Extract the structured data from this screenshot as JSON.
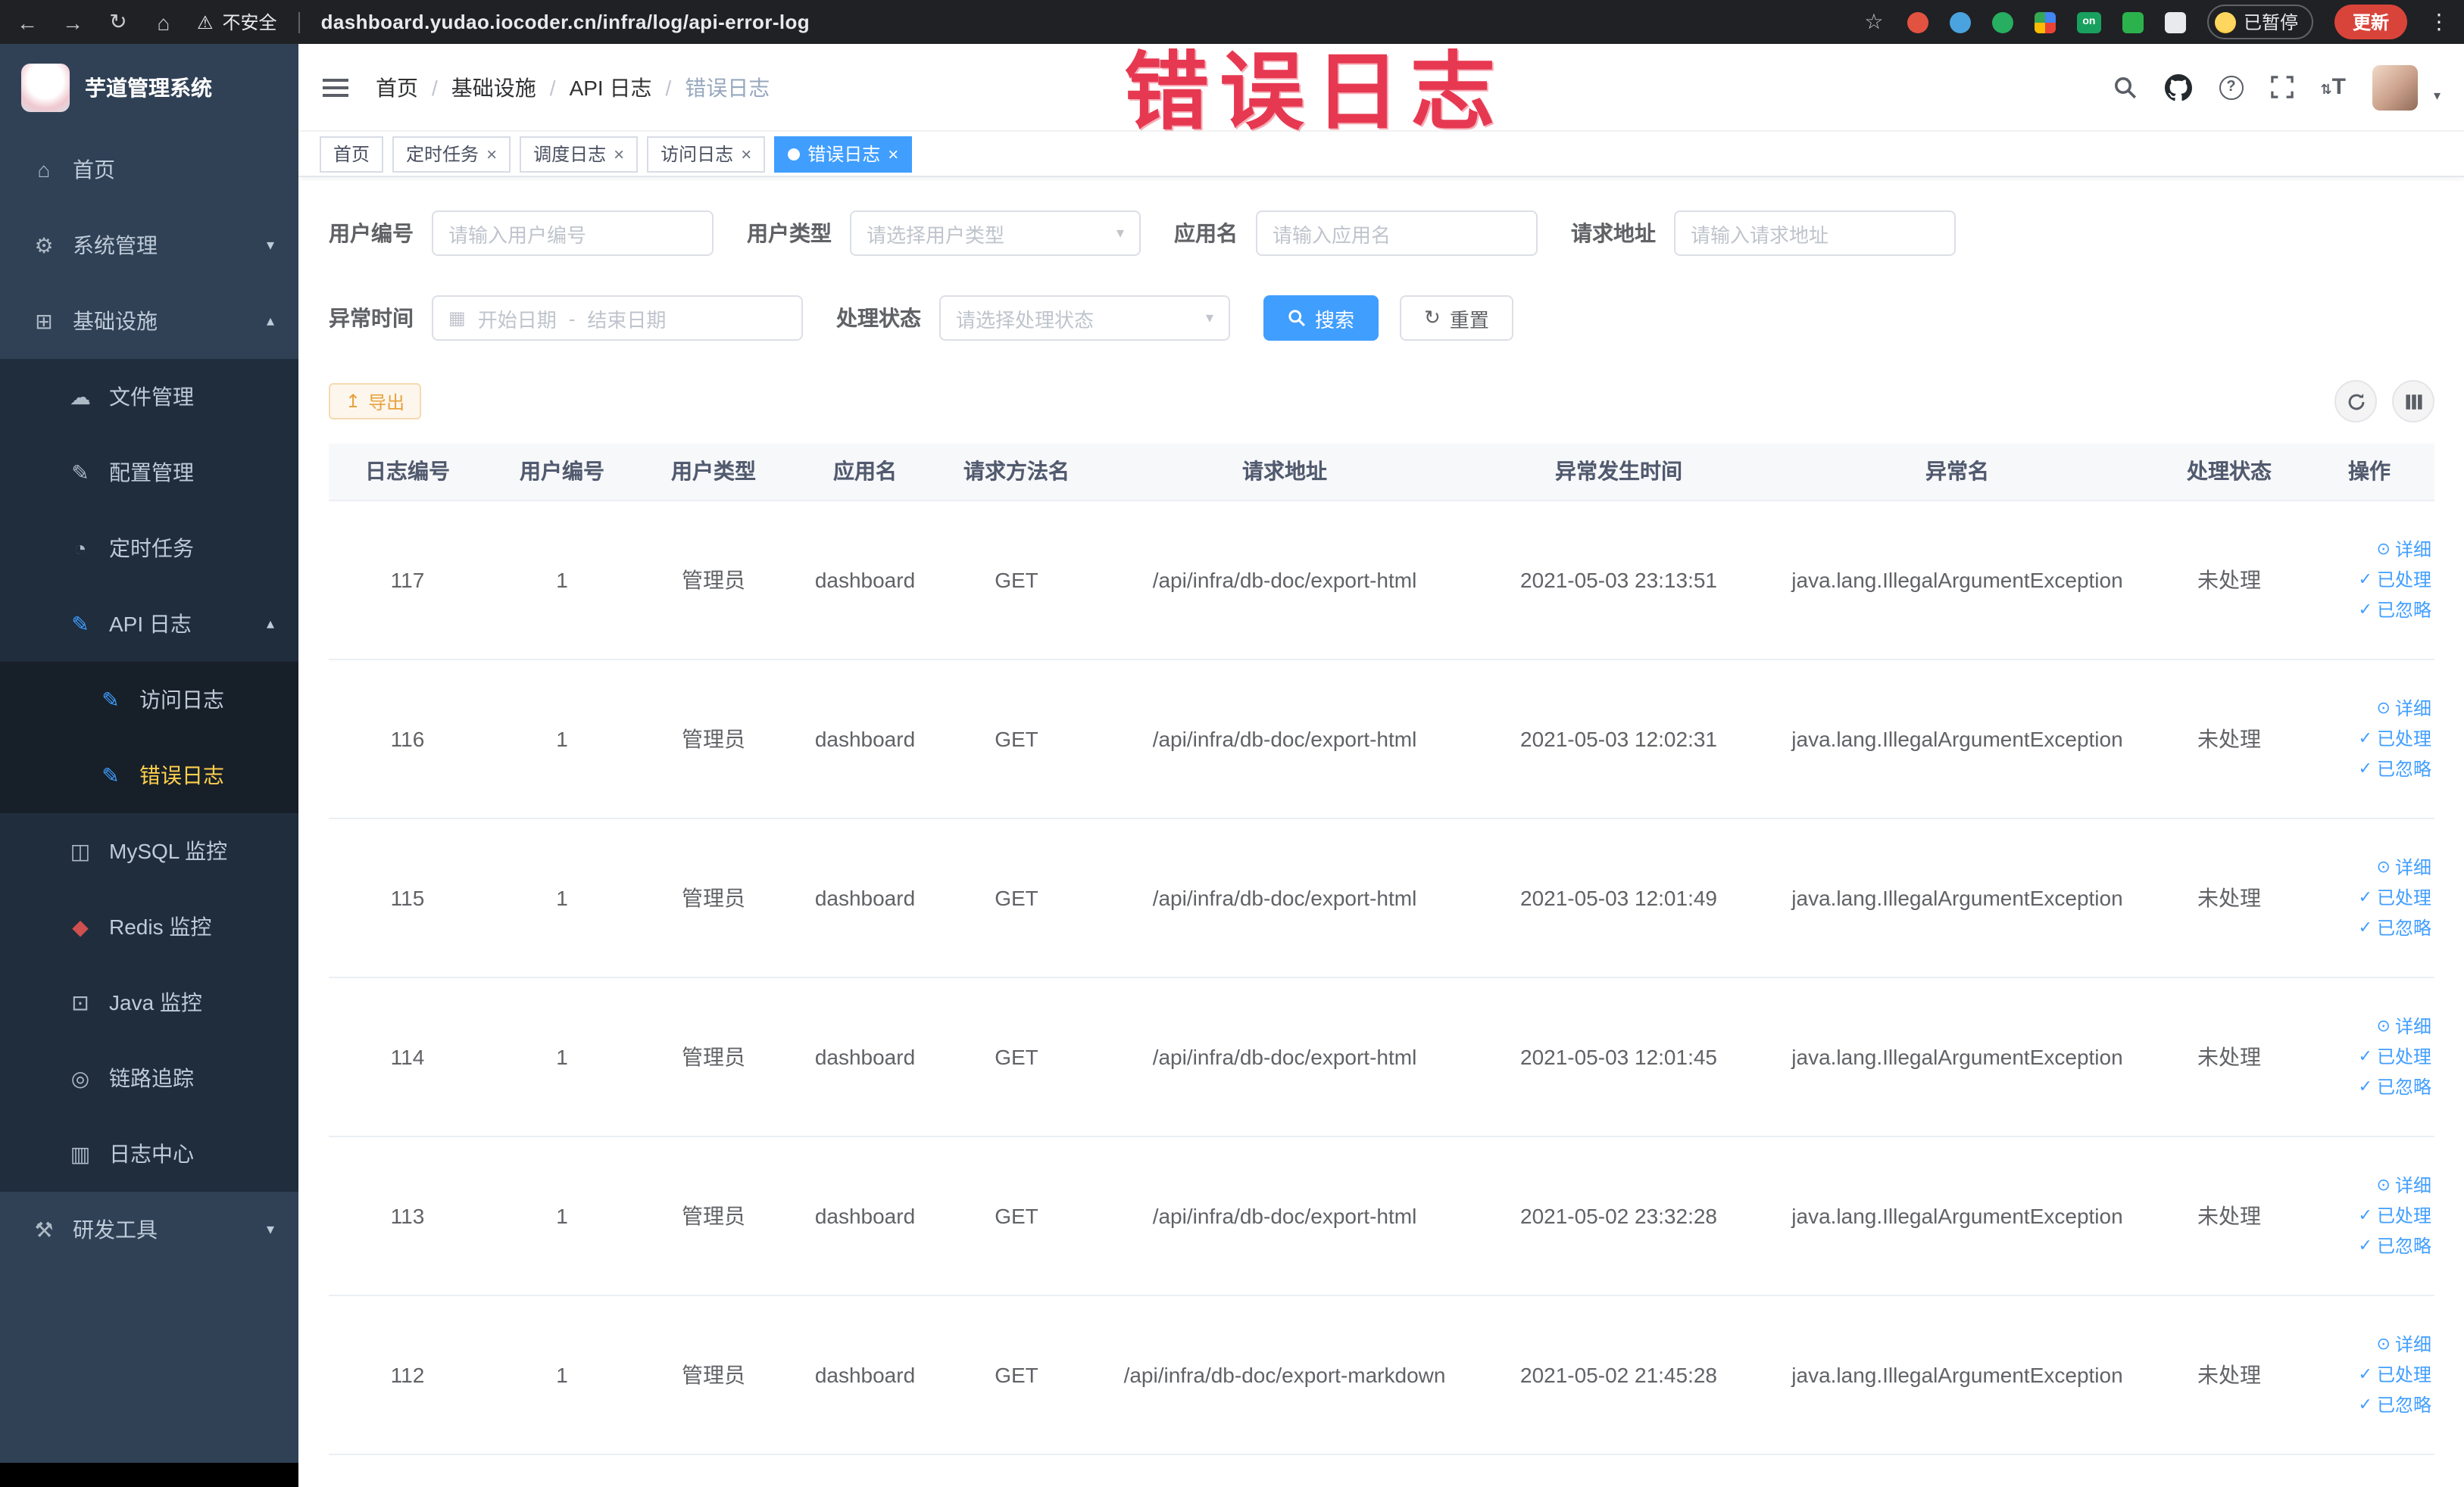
{
  "browser": {
    "security_label": "不安全",
    "url": "dashboard.yudao.iocoder.cn/infra/log/api-error-log",
    "paused_badge": "已暂停",
    "update_button": "更新"
  },
  "watermark_text": "错误日志",
  "icons": {
    "back": "←",
    "forward": "→",
    "reload": "↻",
    "home": "⌂",
    "warning": "⚠",
    "star": "☆",
    "kebab": "⋮",
    "home_menu": "⌂",
    "gear": "⚙",
    "infra": "⊞",
    "cloud": "☁",
    "edit": "✎",
    "timer": "◔",
    "doc": "▤",
    "mysql": "◫",
    "redis": "◆",
    "java": "⊡",
    "trace": "◎",
    "log_center": "▥",
    "tools": "⚒",
    "chevron_down": "▾",
    "chevron_up": "▴",
    "caret_down": "▾",
    "close": "×",
    "eye": "⊙",
    "check": "✓",
    "export_arrow": "↥",
    "calendar": "▦"
  },
  "sidebar": {
    "logo_title": "芋道管理系统",
    "items": [
      {
        "label": "首页"
      },
      {
        "label": "系统管理"
      },
      {
        "label": "基础设施"
      },
      {
        "label": "文件管理"
      },
      {
        "label": "配置管理"
      },
      {
        "label": "定时任务"
      },
      {
        "label": "API 日志"
      },
      {
        "label": "访问日志"
      },
      {
        "label": "错误日志"
      },
      {
        "label": "MySQL 监控"
      },
      {
        "label": "Redis 监控"
      },
      {
        "label": "Java 监控"
      },
      {
        "label": "链路追踪"
      },
      {
        "label": "日志中心"
      },
      {
        "label": "研发工具"
      }
    ]
  },
  "breadcrumb": {
    "items": [
      "首页",
      "基础设施",
      "API 日志",
      "错误日志"
    ]
  },
  "tabs": [
    {
      "label": "首页"
    },
    {
      "label": "定时任务"
    },
    {
      "label": "调度日志"
    },
    {
      "label": "访问日志"
    },
    {
      "label": "错误日志"
    }
  ],
  "filters": {
    "user_id_label": "用户编号",
    "user_id_placeholder": "请输入用户编号",
    "user_type_label": "用户类型",
    "user_type_placeholder": "请选择用户类型",
    "app_name_label": "应用名",
    "app_name_placeholder": "请输入应用名",
    "request_url_label": "请求地址",
    "request_url_placeholder": "请输入请求地址",
    "time_label": "异常时间",
    "time_start_placeholder": "开始日期",
    "time_separator": "-",
    "time_end_placeholder": "结束日期",
    "status_label": "处理状态",
    "status_placeholder": "请选择处理状态",
    "search_button": "搜索",
    "reset_button": "重置"
  },
  "toolbar": {
    "export_button": "导出"
  },
  "table": {
    "columns": [
      "日志编号",
      "用户编号",
      "用户类型",
      "应用名",
      "请求方法名",
      "请求地址",
      "异常发生时间",
      "异常名",
      "处理状态",
      "操作"
    ],
    "actions": {
      "detail": "详细",
      "processed": "已处理",
      "ignore": "已忽略"
    },
    "rows": [
      {
        "log_id": "117",
        "user_id": "1",
        "user_type": "管理员",
        "app_name": "dashboard",
        "method": "GET",
        "url": "/api/infra/db-doc/export-html",
        "time": "2021-05-03 23:13:51",
        "exception": "java.lang.IllegalArgumentException",
        "status": "未处理"
      },
      {
        "log_id": "116",
        "user_id": "1",
        "user_type": "管理员",
        "app_name": "dashboard",
        "method": "GET",
        "url": "/api/infra/db-doc/export-html",
        "time": "2021-05-03 12:02:31",
        "exception": "java.lang.IllegalArgumentException",
        "status": "未处理"
      },
      {
        "log_id": "115",
        "user_id": "1",
        "user_type": "管理员",
        "app_name": "dashboard",
        "method": "GET",
        "url": "/api/infra/db-doc/export-html",
        "time": "2021-05-03 12:01:49",
        "exception": "java.lang.IllegalArgumentException",
        "status": "未处理"
      },
      {
        "log_id": "114",
        "user_id": "1",
        "user_type": "管理员",
        "app_name": "dashboard",
        "method": "GET",
        "url": "/api/infra/db-doc/export-html",
        "time": "2021-05-03 12:01:45",
        "exception": "java.lang.IllegalArgumentException",
        "status": "未处理"
      },
      {
        "log_id": "113",
        "user_id": "1",
        "user_type": "管理员",
        "app_name": "dashboard",
        "method": "GET",
        "url": "/api/infra/db-doc/export-html",
        "time": "2021-05-02 23:32:28",
        "exception": "java.lang.IllegalArgumentException",
        "status": "未处理"
      },
      {
        "log_id": "112",
        "user_id": "1",
        "user_type": "管理员",
        "app_name": "dashboard",
        "method": "GET",
        "url": "/api/infra/db-doc/export-markdown",
        "time": "2021-05-02 21:45:28",
        "exception": "java.lang.IllegalArgumentException",
        "status": "未处理"
      }
    ]
  },
  "colors": {
    "accent": "#409EFF",
    "warning": "#E6A23C",
    "sidebar_active": "#ffd04b",
    "watermark": "#e73851"
  }
}
